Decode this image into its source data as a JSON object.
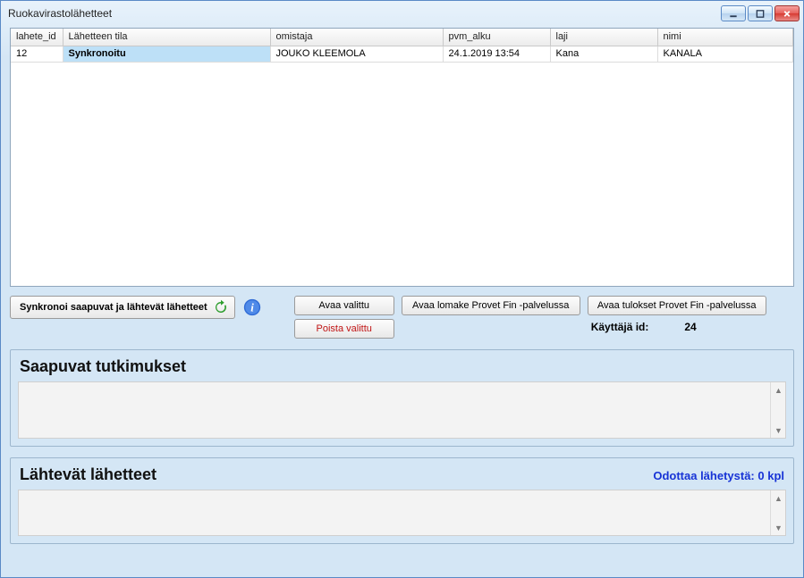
{
  "window": {
    "title": "Ruokavirastolähetteet"
  },
  "grid": {
    "columns": {
      "id": "lahete_id",
      "status": "Lähetteen tila",
      "owner": "omistaja",
      "date": "pvm_alku",
      "species": "laji",
      "name": "nimi"
    },
    "rows": [
      {
        "id": "12",
        "status": "Synkronoitu",
        "owner": "JOUKO KLEEMOLA",
        "date": "24.1.2019 13:54",
        "species": "Kana",
        "name": "KANALA"
      }
    ]
  },
  "buttons": {
    "sync": "Synkronoi saapuvat ja lähtevät lähetteet",
    "open_selected": "Avaa valittu",
    "delete_selected": "Poista valittu",
    "open_form": "Avaa lomake Provet Fin -palvelussa",
    "open_results": "Avaa tulokset Provet Fin -palvelussa"
  },
  "user": {
    "label": "Käyttäjä id:",
    "value": "24"
  },
  "incoming": {
    "title": "Saapuvat tutkimukset"
  },
  "outgoing": {
    "title": "Lähtevät lähetteet",
    "status": "Odottaa lähetystä: 0 kpl"
  }
}
